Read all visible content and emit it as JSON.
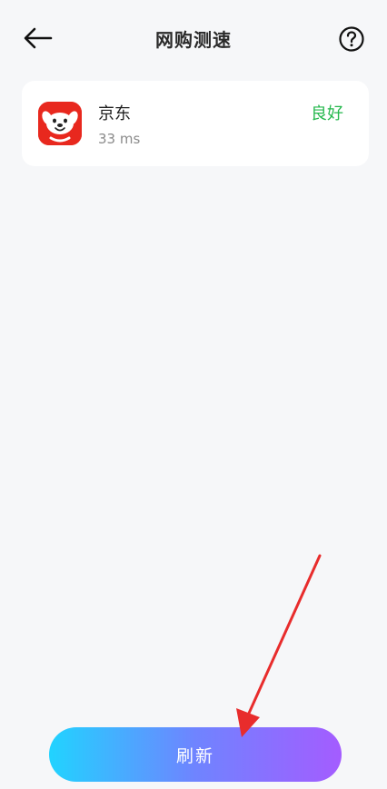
{
  "header": {
    "title": "网购测速",
    "back_icon": "arrow-left-icon",
    "help_icon": "question-circle-icon"
  },
  "items": [
    {
      "app_name": "京东",
      "latency": "33 ms",
      "status": "良好",
      "status_color": "#25b84d",
      "icon": "jd-app-icon"
    }
  ],
  "actions": {
    "refresh_label": "刷新"
  },
  "colors": {
    "background": "#f6f7f9",
    "card": "#ffffff",
    "button_gradient_start": "#21d3ff",
    "button_gradient_end": "#a45cff",
    "annotation_arrow": "#e82c2c"
  }
}
